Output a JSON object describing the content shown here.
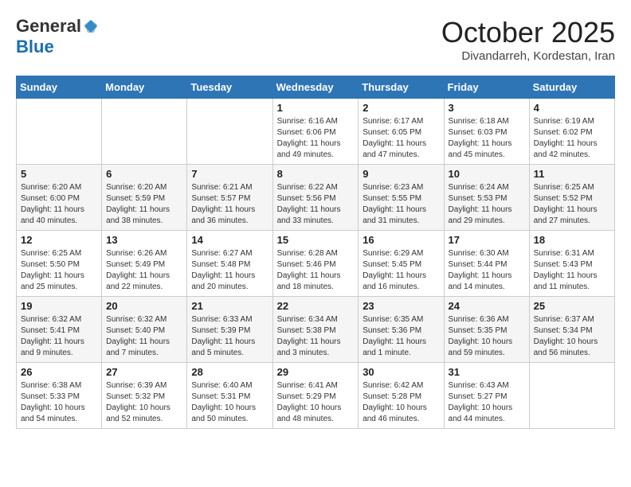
{
  "logo": {
    "general": "General",
    "blue": "Blue"
  },
  "header": {
    "month": "October 2025",
    "location": "Divandarreh, Kordestan, Iran"
  },
  "weekdays": [
    "Sunday",
    "Monday",
    "Tuesday",
    "Wednesday",
    "Thursday",
    "Friday",
    "Saturday"
  ],
  "weeks": [
    [
      {
        "day": "",
        "info": ""
      },
      {
        "day": "",
        "info": ""
      },
      {
        "day": "",
        "info": ""
      },
      {
        "day": "1",
        "info": "Sunrise: 6:16 AM\nSunset: 6:06 PM\nDaylight: 11 hours\nand 49 minutes."
      },
      {
        "day": "2",
        "info": "Sunrise: 6:17 AM\nSunset: 6:05 PM\nDaylight: 11 hours\nand 47 minutes."
      },
      {
        "day": "3",
        "info": "Sunrise: 6:18 AM\nSunset: 6:03 PM\nDaylight: 11 hours\nand 45 minutes."
      },
      {
        "day": "4",
        "info": "Sunrise: 6:19 AM\nSunset: 6:02 PM\nDaylight: 11 hours\nand 42 minutes."
      }
    ],
    [
      {
        "day": "5",
        "info": "Sunrise: 6:20 AM\nSunset: 6:00 PM\nDaylight: 11 hours\nand 40 minutes."
      },
      {
        "day": "6",
        "info": "Sunrise: 6:20 AM\nSunset: 5:59 PM\nDaylight: 11 hours\nand 38 minutes."
      },
      {
        "day": "7",
        "info": "Sunrise: 6:21 AM\nSunset: 5:57 PM\nDaylight: 11 hours\nand 36 minutes."
      },
      {
        "day": "8",
        "info": "Sunrise: 6:22 AM\nSunset: 5:56 PM\nDaylight: 11 hours\nand 33 minutes."
      },
      {
        "day": "9",
        "info": "Sunrise: 6:23 AM\nSunset: 5:55 PM\nDaylight: 11 hours\nand 31 minutes."
      },
      {
        "day": "10",
        "info": "Sunrise: 6:24 AM\nSunset: 5:53 PM\nDaylight: 11 hours\nand 29 minutes."
      },
      {
        "day": "11",
        "info": "Sunrise: 6:25 AM\nSunset: 5:52 PM\nDaylight: 11 hours\nand 27 minutes."
      }
    ],
    [
      {
        "day": "12",
        "info": "Sunrise: 6:25 AM\nSunset: 5:50 PM\nDaylight: 11 hours\nand 25 minutes."
      },
      {
        "day": "13",
        "info": "Sunrise: 6:26 AM\nSunset: 5:49 PM\nDaylight: 11 hours\nand 22 minutes."
      },
      {
        "day": "14",
        "info": "Sunrise: 6:27 AM\nSunset: 5:48 PM\nDaylight: 11 hours\nand 20 minutes."
      },
      {
        "day": "15",
        "info": "Sunrise: 6:28 AM\nSunset: 5:46 PM\nDaylight: 11 hours\nand 18 minutes."
      },
      {
        "day": "16",
        "info": "Sunrise: 6:29 AM\nSunset: 5:45 PM\nDaylight: 11 hours\nand 16 minutes."
      },
      {
        "day": "17",
        "info": "Sunrise: 6:30 AM\nSunset: 5:44 PM\nDaylight: 11 hours\nand 14 minutes."
      },
      {
        "day": "18",
        "info": "Sunrise: 6:31 AM\nSunset: 5:43 PM\nDaylight: 11 hours\nand 11 minutes."
      }
    ],
    [
      {
        "day": "19",
        "info": "Sunrise: 6:32 AM\nSunset: 5:41 PM\nDaylight: 11 hours\nand 9 minutes."
      },
      {
        "day": "20",
        "info": "Sunrise: 6:32 AM\nSunset: 5:40 PM\nDaylight: 11 hours\nand 7 minutes."
      },
      {
        "day": "21",
        "info": "Sunrise: 6:33 AM\nSunset: 5:39 PM\nDaylight: 11 hours\nand 5 minutes."
      },
      {
        "day": "22",
        "info": "Sunrise: 6:34 AM\nSunset: 5:38 PM\nDaylight: 11 hours\nand 3 minutes."
      },
      {
        "day": "23",
        "info": "Sunrise: 6:35 AM\nSunset: 5:36 PM\nDaylight: 11 hours\nand 1 minute."
      },
      {
        "day": "24",
        "info": "Sunrise: 6:36 AM\nSunset: 5:35 PM\nDaylight: 10 hours\nand 59 minutes."
      },
      {
        "day": "25",
        "info": "Sunrise: 6:37 AM\nSunset: 5:34 PM\nDaylight: 10 hours\nand 56 minutes."
      }
    ],
    [
      {
        "day": "26",
        "info": "Sunrise: 6:38 AM\nSunset: 5:33 PM\nDaylight: 10 hours\nand 54 minutes."
      },
      {
        "day": "27",
        "info": "Sunrise: 6:39 AM\nSunset: 5:32 PM\nDaylight: 10 hours\nand 52 minutes."
      },
      {
        "day": "28",
        "info": "Sunrise: 6:40 AM\nSunset: 5:31 PM\nDaylight: 10 hours\nand 50 minutes."
      },
      {
        "day": "29",
        "info": "Sunrise: 6:41 AM\nSunset: 5:29 PM\nDaylight: 10 hours\nand 48 minutes."
      },
      {
        "day": "30",
        "info": "Sunrise: 6:42 AM\nSunset: 5:28 PM\nDaylight: 10 hours\nand 46 minutes."
      },
      {
        "day": "31",
        "info": "Sunrise: 6:43 AM\nSunset: 5:27 PM\nDaylight: 10 hours\nand 44 minutes."
      },
      {
        "day": "",
        "info": ""
      }
    ]
  ]
}
